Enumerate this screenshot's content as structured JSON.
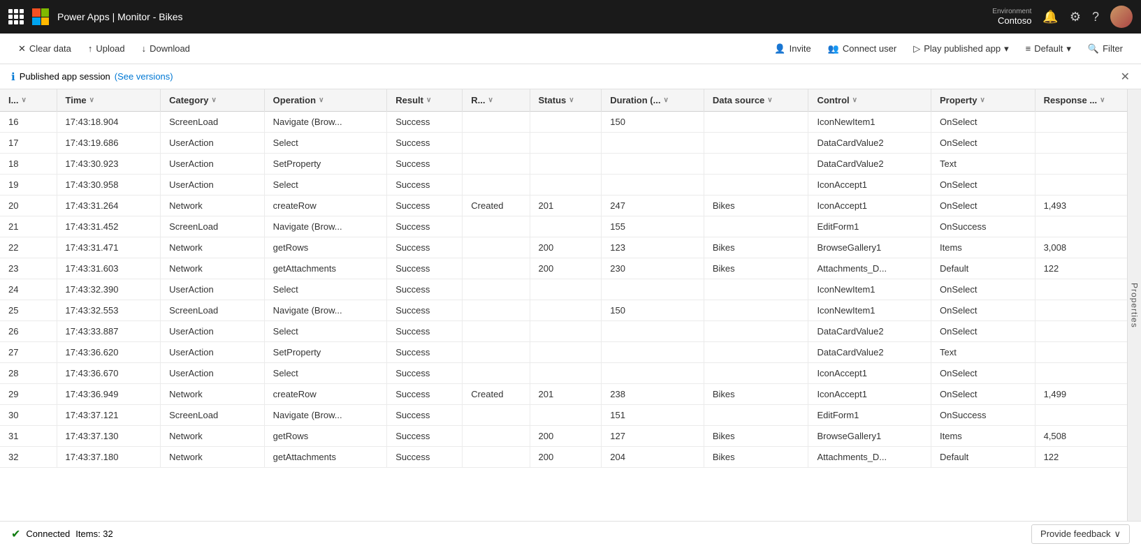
{
  "app": {
    "title": "Power Apps | Monitor - Bikes",
    "environment_label": "Environment",
    "environment_name": "Contoso"
  },
  "toolbar": {
    "clear_data": "Clear data",
    "upload": "Upload",
    "download": "Download",
    "invite": "Invite",
    "connect_user": "Connect user",
    "play_published_app": "Play published app",
    "default": "Default",
    "filter": "Filter"
  },
  "infobar": {
    "text": "Published app session",
    "link_text": "(See versions)"
  },
  "columns": [
    {
      "id": "id",
      "label": "I..."
    },
    {
      "id": "time",
      "label": "Time"
    },
    {
      "id": "category",
      "label": "Category"
    },
    {
      "id": "operation",
      "label": "Operation"
    },
    {
      "id": "result",
      "label": "Result"
    },
    {
      "id": "r",
      "label": "R..."
    },
    {
      "id": "status",
      "label": "Status"
    },
    {
      "id": "duration",
      "label": "Duration (..."
    },
    {
      "id": "datasource",
      "label": "Data source"
    },
    {
      "id": "control",
      "label": "Control"
    },
    {
      "id": "property",
      "label": "Property"
    },
    {
      "id": "response",
      "label": "Response ..."
    }
  ],
  "rows": [
    {
      "id": 16,
      "time": "17:43:18.904",
      "category": "ScreenLoad",
      "operation": "Navigate (Brow...",
      "result": "Success",
      "r": "",
      "status": "",
      "duration": "150",
      "datasource": "",
      "control": "IconNewItem1",
      "property": "OnSelect",
      "response": ""
    },
    {
      "id": 17,
      "time": "17:43:19.686",
      "category": "UserAction",
      "operation": "Select",
      "result": "Success",
      "r": "",
      "status": "",
      "duration": "",
      "datasource": "",
      "control": "DataCardValue2",
      "property": "OnSelect",
      "response": ""
    },
    {
      "id": 18,
      "time": "17:43:30.923",
      "category": "UserAction",
      "operation": "SetProperty",
      "result": "Success",
      "r": "",
      "status": "",
      "duration": "",
      "datasource": "",
      "control": "DataCardValue2",
      "property": "Text",
      "response": ""
    },
    {
      "id": 19,
      "time": "17:43:30.958",
      "category": "UserAction",
      "operation": "Select",
      "result": "Success",
      "r": "",
      "status": "",
      "duration": "",
      "datasource": "",
      "control": "IconAccept1",
      "property": "OnSelect",
      "response": ""
    },
    {
      "id": 20,
      "time": "17:43:31.264",
      "category": "Network",
      "operation": "createRow",
      "result": "Success",
      "r": "Created",
      "status": "201",
      "duration": "247",
      "datasource": "Bikes",
      "control": "IconAccept1",
      "property": "OnSelect",
      "response": "1,493"
    },
    {
      "id": 21,
      "time": "17:43:31.452",
      "category": "ScreenLoad",
      "operation": "Navigate (Brow...",
      "result": "Success",
      "r": "",
      "status": "",
      "duration": "155",
      "datasource": "",
      "control": "EditForm1",
      "property": "OnSuccess",
      "response": ""
    },
    {
      "id": 22,
      "time": "17:43:31.471",
      "category": "Network",
      "operation": "getRows",
      "result": "Success",
      "r": "",
      "status": "200",
      "duration": "123",
      "datasource": "Bikes",
      "control": "BrowseGallery1",
      "property": "Items",
      "response": "3,008"
    },
    {
      "id": 23,
      "time": "17:43:31.603",
      "category": "Network",
      "operation": "getAttachments",
      "result": "Success",
      "r": "",
      "status": "200",
      "duration": "230",
      "datasource": "Bikes",
      "control": "Attachments_D...",
      "property": "Default",
      "response": "122"
    },
    {
      "id": 24,
      "time": "17:43:32.390",
      "category": "UserAction",
      "operation": "Select",
      "result": "Success",
      "r": "",
      "status": "",
      "duration": "",
      "datasource": "",
      "control": "IconNewItem1",
      "property": "OnSelect",
      "response": ""
    },
    {
      "id": 25,
      "time": "17:43:32.553",
      "category": "ScreenLoad",
      "operation": "Navigate (Brow...",
      "result": "Success",
      "r": "",
      "status": "",
      "duration": "150",
      "datasource": "",
      "control": "IconNewItem1",
      "property": "OnSelect",
      "response": ""
    },
    {
      "id": 26,
      "time": "17:43:33.887",
      "category": "UserAction",
      "operation": "Select",
      "result": "Success",
      "r": "",
      "status": "",
      "duration": "",
      "datasource": "",
      "control": "DataCardValue2",
      "property": "OnSelect",
      "response": ""
    },
    {
      "id": 27,
      "time": "17:43:36.620",
      "category": "UserAction",
      "operation": "SetProperty",
      "result": "Success",
      "r": "",
      "status": "",
      "duration": "",
      "datasource": "",
      "control": "DataCardValue2",
      "property": "Text",
      "response": ""
    },
    {
      "id": 28,
      "time": "17:43:36.670",
      "category": "UserAction",
      "operation": "Select",
      "result": "Success",
      "r": "",
      "status": "",
      "duration": "",
      "datasource": "",
      "control": "IconAccept1",
      "property": "OnSelect",
      "response": ""
    },
    {
      "id": 29,
      "time": "17:43:36.949",
      "category": "Network",
      "operation": "createRow",
      "result": "Success",
      "r": "Created",
      "status": "201",
      "duration": "238",
      "datasource": "Bikes",
      "control": "IconAccept1",
      "property": "OnSelect",
      "response": "1,499"
    },
    {
      "id": 30,
      "time": "17:43:37.121",
      "category": "ScreenLoad",
      "operation": "Navigate (Brow...",
      "result": "Success",
      "r": "",
      "status": "",
      "duration": "151",
      "datasource": "",
      "control": "EditForm1",
      "property": "OnSuccess",
      "response": ""
    },
    {
      "id": 31,
      "time": "17:43:37.130",
      "category": "Network",
      "operation": "getRows",
      "result": "Success",
      "r": "",
      "status": "200",
      "duration": "127",
      "datasource": "Bikes",
      "control": "BrowseGallery1",
      "property": "Items",
      "response": "4,508"
    },
    {
      "id": 32,
      "time": "17:43:37.180",
      "category": "Network",
      "operation": "getAttachments",
      "result": "Success",
      "r": "",
      "status": "200",
      "duration": "204",
      "datasource": "Bikes",
      "control": "Attachments_D...",
      "property": "Default",
      "response": "122"
    }
  ],
  "statusbar": {
    "connected": "Connected",
    "items": "Items: 32"
  },
  "feedback": {
    "label": "Provide feedback"
  },
  "properties_panel": {
    "label": "Properties"
  }
}
